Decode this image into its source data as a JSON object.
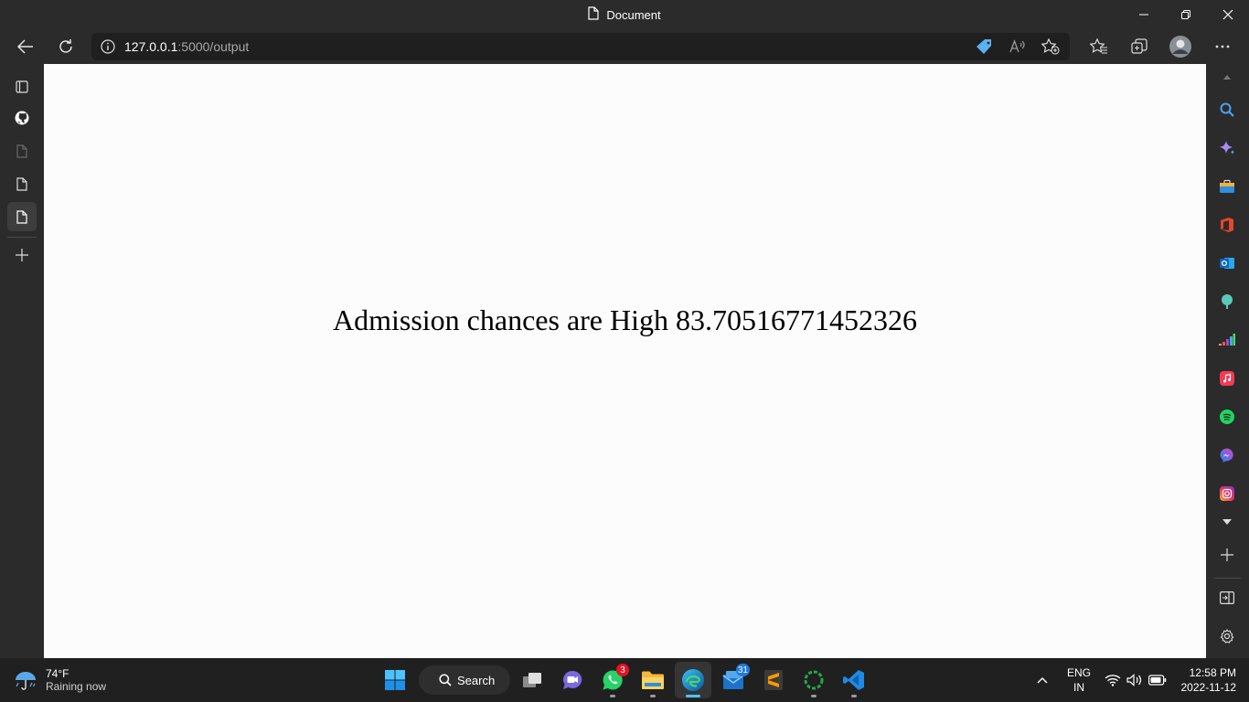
{
  "window": {
    "title": "Document",
    "title_icon": "document-icon",
    "controls": [
      "minimize-icon",
      "restore-icon",
      "close-icon"
    ]
  },
  "toolbar": {
    "back_icon": "back-arrow-icon",
    "refresh_icon": "refresh-icon",
    "url_host": "127.0.0.1",
    "url_rest": ":5000/output",
    "address_icons": [
      "site-info-icon",
      "coupon-tag-icon",
      "read-aloud-icon",
      "add-favorite-icon"
    ],
    "right_icons": [
      "favorites-icon",
      "collections-icon",
      "profile-avatar",
      "more-icon"
    ]
  },
  "vertical_tabs": {
    "items": [
      "tab-actions-icon",
      "github-icon",
      "document-icon",
      "document-icon",
      "document-icon"
    ],
    "new_tab_icon": "plus-icon"
  },
  "page": {
    "result_text": "Admission chances are High 83.70516771452326"
  },
  "right_sidebar": {
    "items": [
      "search-icon",
      "copilot-icon",
      "shopping-icon",
      "office-icon",
      "outlook-icon",
      "tree-icon",
      "deezer-icon",
      "apple-music-icon",
      "spotify-icon",
      "messenger-icon",
      "instagram-icon",
      "chevron-down-icon",
      "plus-icon",
      "split-screen-icon",
      "settings-icon"
    ]
  },
  "taskbar": {
    "weather_temp": "74°F",
    "weather_desc": "Raining now",
    "search_label": "Search",
    "whatsapp_badge": "3",
    "mail_badge": "31",
    "lang_line1": "ENG",
    "lang_line2": "IN",
    "time": "12:58 PM",
    "date": "2022-11-12",
    "colors": {
      "taskbar_bg": "#202020",
      "accent": "#4cc2ff",
      "badge_red": "#e81123",
      "badge_blue": "#1f7ae0"
    }
  }
}
